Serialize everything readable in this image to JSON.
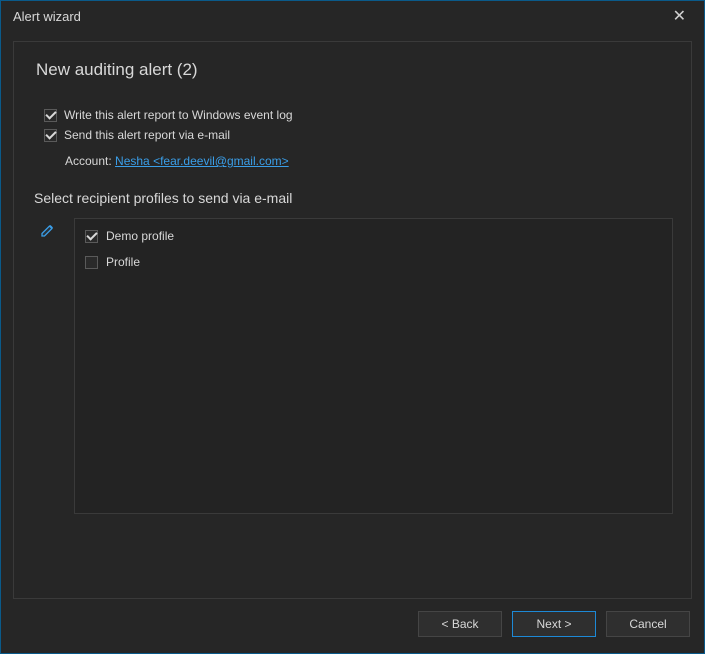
{
  "window": {
    "title": "Alert wizard"
  },
  "alert": {
    "title": "New auditing alert (2)"
  },
  "options": {
    "write_event_log": {
      "label": "Write this alert report to Windows event log",
      "checked": true
    },
    "send_email": {
      "label": "Send this alert report via e-mail",
      "checked": true
    },
    "account_label": "Account:",
    "account_value": "Nesha <fear.deevil@gmail.com>"
  },
  "profiles": {
    "header": "Select recipient profiles to send via e-mail",
    "items": [
      {
        "label": "Demo profile",
        "checked": true
      },
      {
        "label": "Profile",
        "checked": false
      }
    ]
  },
  "buttons": {
    "back": "< Back",
    "next": "Next >",
    "cancel": "Cancel"
  }
}
